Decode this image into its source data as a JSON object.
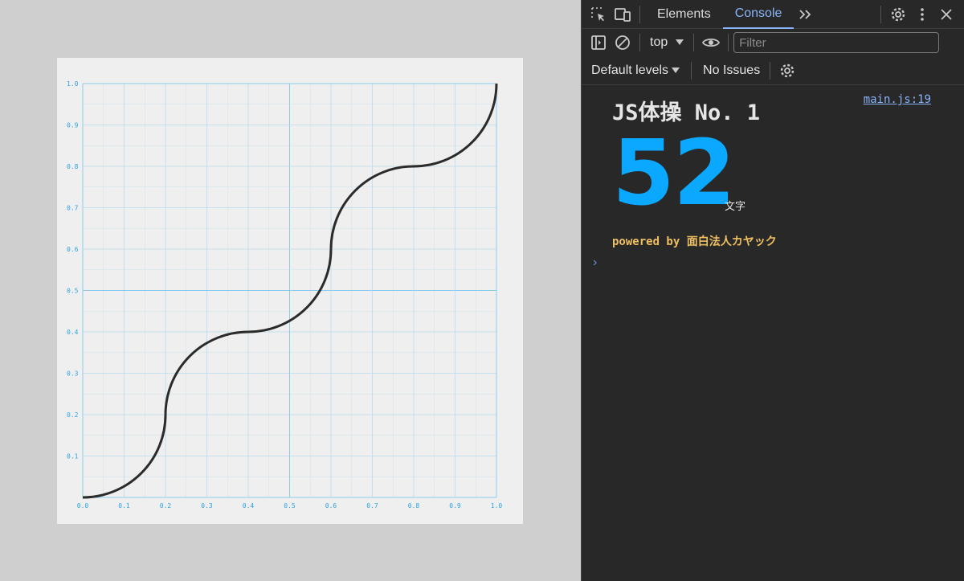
{
  "plot": {
    "x_ticks": [
      "0.0",
      "0.1",
      "0.2",
      "0.3",
      "0.4",
      "0.5",
      "0.6",
      "0.7",
      "0.8",
      "0.9",
      "1.0"
    ],
    "y_ticks": [
      "0.1",
      "0.2",
      "0.3",
      "0.4",
      "0.5",
      "0.6",
      "0.7",
      "0.8",
      "0.9",
      "1.0"
    ],
    "colors": {
      "grid": "#b9dcee",
      "grid_major": "#8ccbeb",
      "ticks": "#2ba3e0",
      "curve": "#2b2b2b"
    }
  },
  "chart_data": {
    "type": "line",
    "xlim": [
      0,
      1
    ],
    "ylim": [
      0,
      1
    ],
    "grid": true,
    "segments": [
      {
        "from": [
          0.0,
          0.0
        ],
        "to": [
          0.2,
          0.2
        ],
        "shape": "concave-up-arc"
      },
      {
        "from": [
          0.2,
          0.2
        ],
        "to": [
          0.4,
          0.4
        ],
        "shape": "convex-arc"
      },
      {
        "from": [
          0.4,
          0.4
        ],
        "to": [
          0.6,
          0.6
        ],
        "shape": "concave-up-arc"
      },
      {
        "from": [
          0.6,
          0.6
        ],
        "to": [
          0.8,
          0.8
        ],
        "shape": "convex-arc"
      },
      {
        "from": [
          0.8,
          0.8
        ],
        "to": [
          1.0,
          1.0
        ],
        "shape": "concave-up-arc"
      }
    ]
  },
  "devtools": {
    "tabs": [
      {
        "label": "Elements",
        "active": false
      },
      {
        "label": "Console",
        "active": true
      }
    ],
    "context": "top",
    "filter_placeholder": "Filter",
    "levels": "Default levels",
    "issues": "No Issues",
    "accent": "#8ab4f8",
    "console": {
      "title": "JS体操 No. 1",
      "source": "main.js:19",
      "number": "52",
      "unit": "文字",
      "powered": "powered by 面白法人カヤック",
      "number_color": "#0aa8ff",
      "powered_color": "#f0c060"
    }
  }
}
